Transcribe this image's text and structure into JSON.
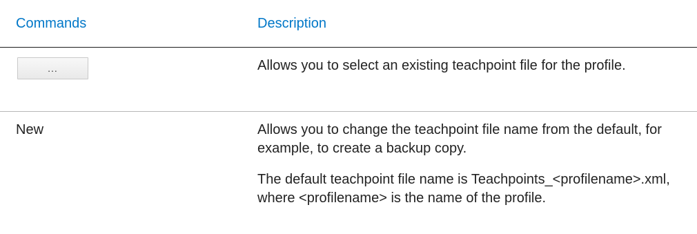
{
  "table": {
    "headers": {
      "commands": "Commands",
      "description": "Description"
    },
    "rows": [
      {
        "command_button_label": "...",
        "description": "Allows you to select an existing teachpoint file for the profile."
      },
      {
        "command": "New",
        "description": "Allows you to change the teachpoint file name from the default, for example, to create a backup copy.",
        "description_note": "The default teachpoint file name is Teachpoints_<profilename>.xml, where <profilename> is the name of the profile."
      }
    ]
  },
  "colors": {
    "header_text": "#0077c8",
    "body_text": "#222222",
    "header_rule": "#1a1a1a",
    "row_rule": "#b8b8b8"
  }
}
